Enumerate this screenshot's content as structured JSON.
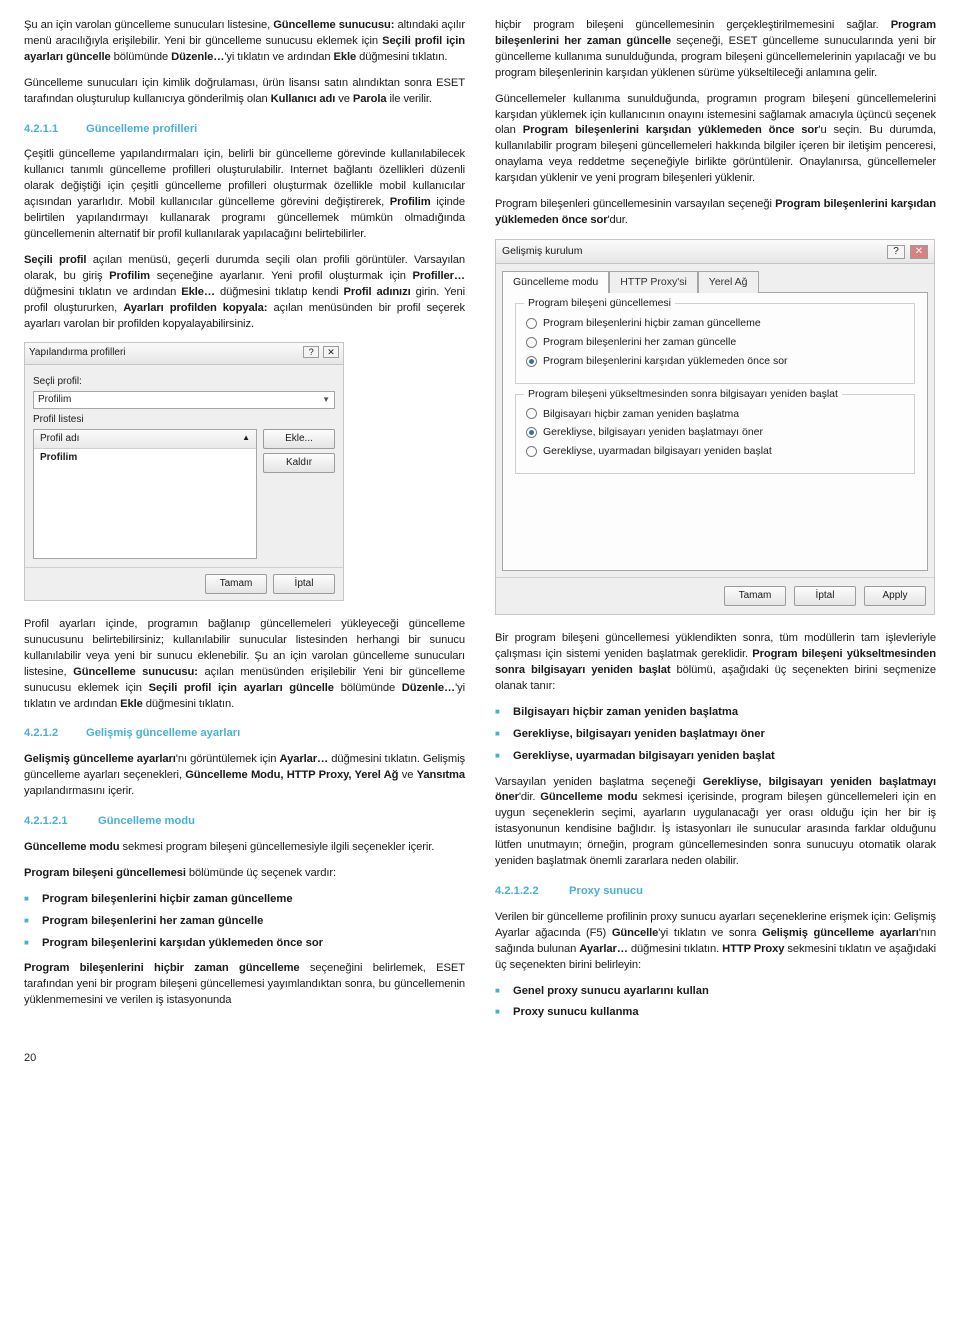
{
  "pageNumber": "20",
  "left": {
    "p1_a": "Şu an için varolan güncelleme sunucuları listesine, ",
    "p1_b": "Güncelleme sunucusu:",
    "p1_c": " altındaki açılır menü aracılığıyla erişilebilir. Yeni bir güncelleme sunucusu eklemek için ",
    "p1_d": "Seçili profil için ayarları güncelle",
    "p1_e": " bölümünde ",
    "p1_f": "Düzenle…",
    "p1_g": "'yi tıklatın ve ardından ",
    "p1_h": "Ekle",
    "p1_i": " düğmesini tıklatın.",
    "p2_a": "Güncelleme sunucuları için kimlik doğrulaması, ürün lisansı satın alındıktan sonra ESET tarafından oluşturulup kullanıcıya gönderilmiş olan ",
    "p2_b": "Kullanıcı adı",
    "p2_c": " ve ",
    "p2_d": "Parola",
    "p2_e": " ile verilir.",
    "h1_num": "4.2.1.1",
    "h1_txt": "Güncelleme profilleri",
    "p3": "Çeşitli güncelleme yapılandırmaları için, belirli bir güncelleme görevinde kullanılabilecek kullanıcı tanımlı güncelleme profilleri oluşturulabilir. Internet bağlantı özellikleri düzenli olarak değiştiği için çeşitli güncelleme profilleri oluşturmak özellikle mobil kullanıcılar açısından yararlıdır. Mobil kullanıcılar güncelleme görevini değiştirerek, ",
    "p3_b": "Profilim",
    "p3_c": " içinde belirtilen yapılandırmayı kullanarak programı güncellemek mümkün olmadığında güncellemenin alternatif bir profil kullanılarak yapılacağını belirtebilirler.",
    "p4_a": "Seçili profil",
    "p4_b": " açılan menüsü, geçerli durumda seçili olan profili görüntüler. Varsayılan olarak, bu giriş ",
    "p4_c": "Profilim",
    "p4_d": " seçeneğine ayarlanır. Yeni profil oluşturmak için ",
    "p4_e": "Profiller…",
    "p4_f": " düğmesini tıklatın ve ardından ",
    "p4_g": "Ekle…",
    "p4_h": " düğmesini tıklatıp kendi ",
    "p4_i": "Profil adınızı",
    "p4_j": " girin. Yeni profil oluştururken, ",
    "p4_k": "Ayarları profilden kopyala:",
    "p4_l": " açılan menüsünden bir profil seçerek ayarları varolan bir profilden kopyalayabilirsiniz.",
    "p5_a": "Profil ayarları içinde, programın bağlanıp güncellemeleri yükleyeceği güncelleme sunucusunu belirtebilirsiniz; kullanılabilir sunucular listesinden herhangi bir sunucu kullanılabilir veya yeni bir sunucu eklenebilir. Şu an için varolan güncelleme sunucuları listesine, ",
    "p5_b": "Güncelleme sunucusu:",
    "p5_c": " açılan menüsünden erişilebilir Yeni bir güncelleme sunucusu eklemek için ",
    "p5_d": "Seçili profil için ayarları güncelle",
    "p5_e": " bölümünde ",
    "p5_f": "Düzenle…",
    "p5_g": "'yi tıklatın ve ardından ",
    "p5_h": "Ekle",
    "p5_i": " düğmesini tıklatın.",
    "h2_num": "4.2.1.2",
    "h2_txt": "Gelişmiş güncelleme ayarları",
    "p6_a": "Gelişmiş güncelleme ayarları",
    "p6_b": "'nı görüntülemek için ",
    "p6_c": "Ayarlar…",
    "p6_d": " düğmesini tıklatın. Gelişmiş güncelleme ayarları seçenekleri, ",
    "p6_e": "Güncelleme Modu, HTTP Proxy, Yerel Ağ",
    "p6_f": " ve ",
    "p6_g": "Yansıtma",
    "p6_h": " yapılandırmasını içerir.",
    "h3_num": "4.2.1.2.1",
    "h3_txt": "Güncelleme modu",
    "p7_a": "Güncelleme modu",
    "p7_b": " sekmesi program bileşeni güncellemesiyle ilgili seçenekler içerir.",
    "p8_a": "Program bileşeni güncellemesi",
    "p8_b": " bölümünde üç seçenek vardır:",
    "opt1": "Program bileşenlerini hiçbir zaman güncelleme",
    "opt2": "Program bileşenlerini her zaman güncelle",
    "opt3": "Program bileşenlerini karşıdan yüklemeden önce sor",
    "p9_a": "Program bileşenlerini hiçbir zaman güncelleme",
    "p9_b": " seçeneğini belirlemek, ESET tarafından yeni bir program bileşeni güncellemesi yayımlandıktan sonra, bu güncellemenin yüklenmemesini ve verilen iş istasyonunda"
  },
  "right": {
    "p1_a": "hiçbir program bileşeni güncellemesinin gerçekleştirilmemesini sağlar. ",
    "p1_b": "Program bileşenlerini her zaman güncelle",
    "p1_c": " seçeneği, ESET güncelleme sunucularında yeni bir güncelleme kullanıma sunulduğunda, program bileşeni güncellemelerinin yapılacağı ve bu program bileşenlerinin karşıdan yüklenen sürüme yükseltileceği anlamına gelir.",
    "p2_a": "Güncellemeler kullanıma sunulduğunda, programın program bileşeni güncellemelerini karşıdan yüklemek için kullanıcının onayını istemesini sağlamak amacıyla üçüncü seçenek olan ",
    "p2_b": "Program bileşenlerini karşıdan yüklemeden önce sor",
    "p2_c": "'u seçin. Bu durumda, kullanılabilir program bileşeni güncellemeleri hakkında bilgiler içeren bir iletişim penceresi, onaylama veya reddetme seçeneğiyle birlikte görüntülenir. Onaylanırsa, güncellemeler karşıdan yüklenir ve yeni program bileşenleri yüklenir.",
    "p3_a": "Program bileşenleri güncellemesinin varsayılan seçeneği ",
    "p3_b": "Program bileşenlerini karşıdan yüklemeden önce sor",
    "p3_c": "'dur.",
    "p4_a": "Bir program bileşeni güncellemesi yüklendikten sonra, tüm modüllerin tam işlevleriyle çalışması için sistemi yeniden başlatmak gereklidir. ",
    "p4_b": "Program bileşeni yükseltmesinden sonra bilgisayarı yeniden başlat",
    "p4_c": " bölümü, aşağıdaki üç seçenekten birini seçmenize olanak tanır:",
    "ropt1": "Bilgisayarı hiçbir zaman yeniden başlatma",
    "ropt2": "Gerekliyse, bilgisayarı yeniden başlatmayı öner",
    "ropt3": "Gerekliyse, uyarmadan bilgisayarı yeniden başlat",
    "p5_a": "Varsayılan yeniden başlatma seçeneği ",
    "p5_b": "Gerekliyse, bilgisayarı yeniden başlatmayı öner",
    "p5_c": "'dir. ",
    "p5_d": "Güncelleme modu",
    "p5_e": " sekmesi içerisinde, program bileşen güncellemeleri için en uygun seçeneklerin seçimi, ayarların uygulanacağı yer orası olduğu için her bir iş istasyonunun kendisine bağlıdır. İş istasyonları ile sunucular arasında farklar olduğunu lütfen unutmayın; örneğin, program güncellemesinden sonra sunucuyu otomatik olarak yeniden başlatmak önemli zararlara neden olabilir.",
    "h4_num": "4.2.1.2.2",
    "h4_txt": "Proxy sunucu",
    "p6_a": "Verilen bir güncelleme profilinin proxy sunucu ayarları seçeneklerine erişmek için: Gelişmiş Ayarlar ağacında (F5) ",
    "p6_b": "Güncelle",
    "p6_c": "'yi tıklatın ve sonra ",
    "p6_d": "Gelişmiş güncelleme ayarları",
    "p6_e": "'nın sağında bulunan ",
    "p6_f": "Ayarlar…",
    "p6_g": " düğmesini tıklatın. ",
    "p6_h": "HTTP Proxy",
    "p6_i": " sekmesini tıklatın ve aşağıdaki üç seçenekten birini belirleyin:",
    "popt1": "Genel proxy sunucu ayarlarını kullan",
    "popt2": "Proxy sunucu kullanma"
  },
  "shot1": {
    "title": "Yapılandırma profilleri",
    "lbl_selprof": "Seçli profil:",
    "selval": "Profilim",
    "lbl_list": "Profil listesi",
    "col": "Profil adı",
    "row": "Profilim",
    "btn_add": "Ekle...",
    "btn_remove": "Kaldır",
    "btn_ok": "Tamam",
    "btn_cancel": "İptal"
  },
  "shot2": {
    "title": "Gelişmiş kurulum",
    "tab1": "Güncelleme modu",
    "tab2": "HTTP Proxy'si",
    "tab3": "Yerel Ağ",
    "g1": "Program bileşeni güncellemesi",
    "g1o1": "Program bileşenlerini hiçbir zaman güncelleme",
    "g1o2": "Program bileşenlerini her zaman güncelle",
    "g1o3": "Program bileşenlerini karşıdan yüklemeden önce sor",
    "g2": "Program bileşeni yükseltmesinden sonra bilgisayarı yeniden başlat",
    "g2o1": "Bilgisayarı hiçbir zaman yeniden başlatma",
    "g2o2": "Gerekliyse, bilgisayarı yeniden başlatmayı öner",
    "g2o3": "Gerekliyse, uyarmadan bilgisayarı yeniden başlat",
    "btn_ok": "Tamam",
    "btn_cancel": "İptal",
    "btn_apply": "Apply"
  }
}
